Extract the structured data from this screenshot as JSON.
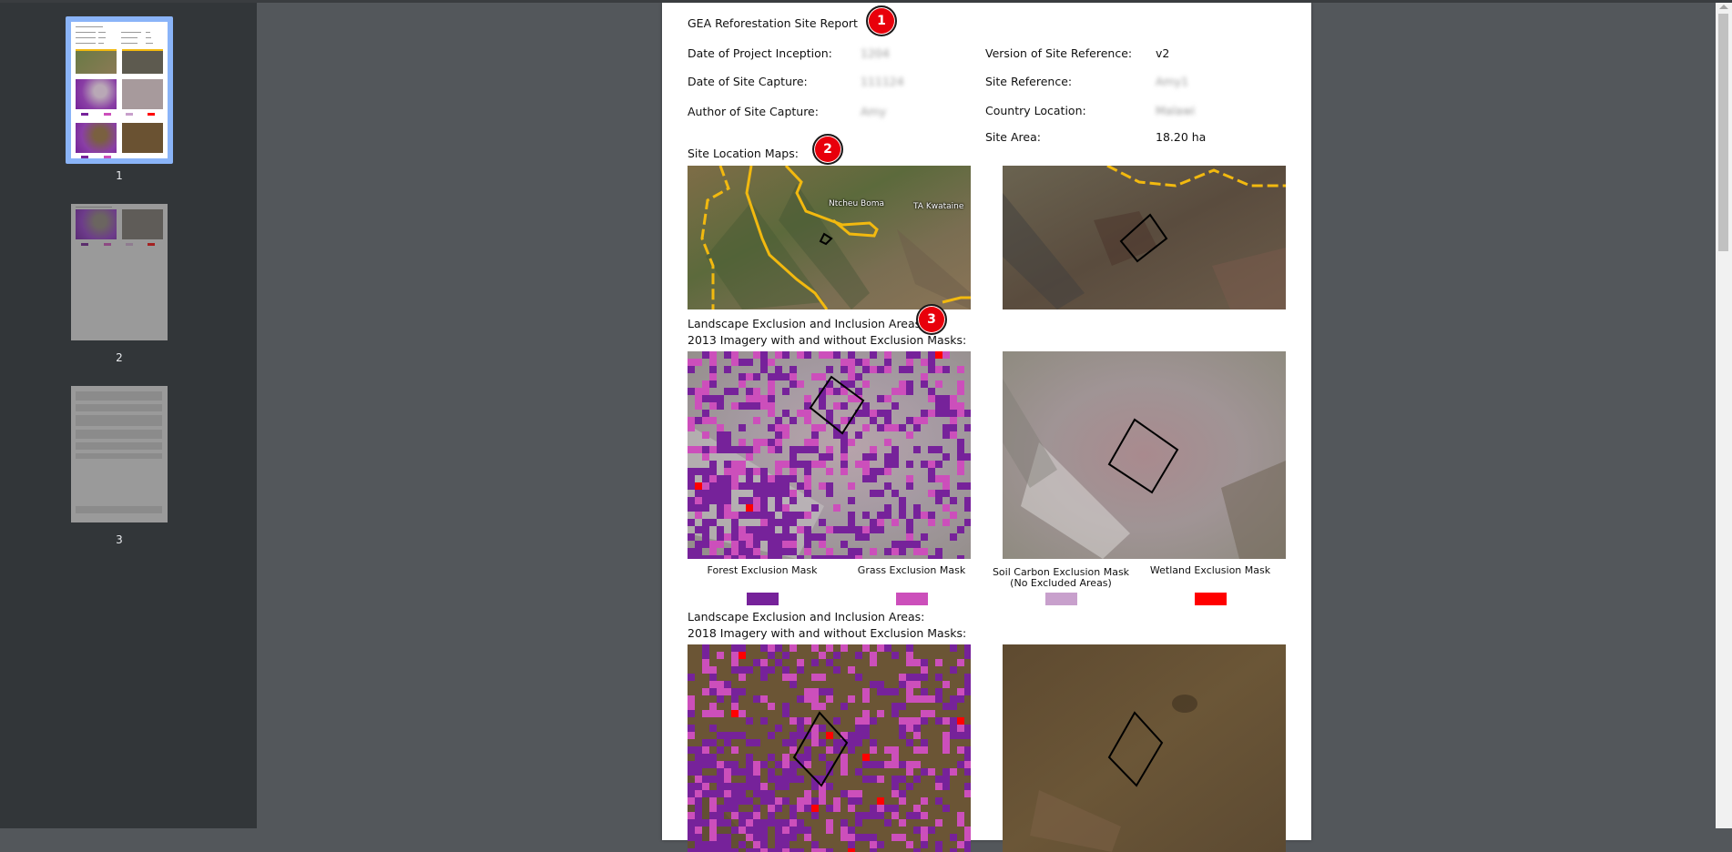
{
  "sidebar": {
    "thumbnails": [
      {
        "page": "1",
        "active": true
      },
      {
        "page": "2",
        "active": false
      },
      {
        "page": "3",
        "active": false
      }
    ]
  },
  "report": {
    "title": "GEA Reforestation Site Report",
    "fields_left": [
      {
        "label": "Date of Project Inception:",
        "value": "1204",
        "redacted": true
      },
      {
        "label": "Date of Site Capture:",
        "value": "111124",
        "redacted": true
      },
      {
        "label": "Author of Site Capture:",
        "value": "Amy",
        "redacted": true
      }
    ],
    "fields_right": [
      {
        "label": "Version of Site Reference:",
        "value": "v2",
        "redacted": false
      },
      {
        "label": "Site Reference:",
        "value": "Amy1",
        "redacted": true
      },
      {
        "label": "Country Location:",
        "value": "Malawi",
        "redacted": true
      },
      {
        "label": "Site Area:",
        "value": "18.20 ha",
        "redacted": false
      }
    ],
    "site_location_heading": "Site Location Maps:",
    "map_labels": [
      "Ntcheu Boma",
      "TA Kwataine"
    ],
    "section_2013": {
      "line1": "Landscape Exclusion and Inclusion Areas:",
      "line2": "2013 Imagery with and without Exclusion Masks:"
    },
    "section_2018": {
      "line1": "Landscape Exclusion and Inclusion Areas:",
      "line2": "2018 Imagery with and without Exclusion Masks:"
    },
    "legend": [
      {
        "label": "Forest Exclusion Mask",
        "label2": "",
        "color": "#76229a"
      },
      {
        "label": "Grass Exclusion Mask",
        "label2": "",
        "color": "#cc4fbb"
      },
      {
        "label": "Soil Carbon Exclusion Mask",
        "label2": "(No Excluded Areas)",
        "color": "#c8a0cc"
      },
      {
        "label": "Wetland Exclusion Mask",
        "label2": "",
        "color": "#ff0000"
      }
    ]
  },
  "annotations": [
    {
      "number": "1",
      "color": "#e8000b"
    },
    {
      "number": "2",
      "color": "#e8000b"
    },
    {
      "number": "3",
      "color": "#e8000b"
    }
  ]
}
